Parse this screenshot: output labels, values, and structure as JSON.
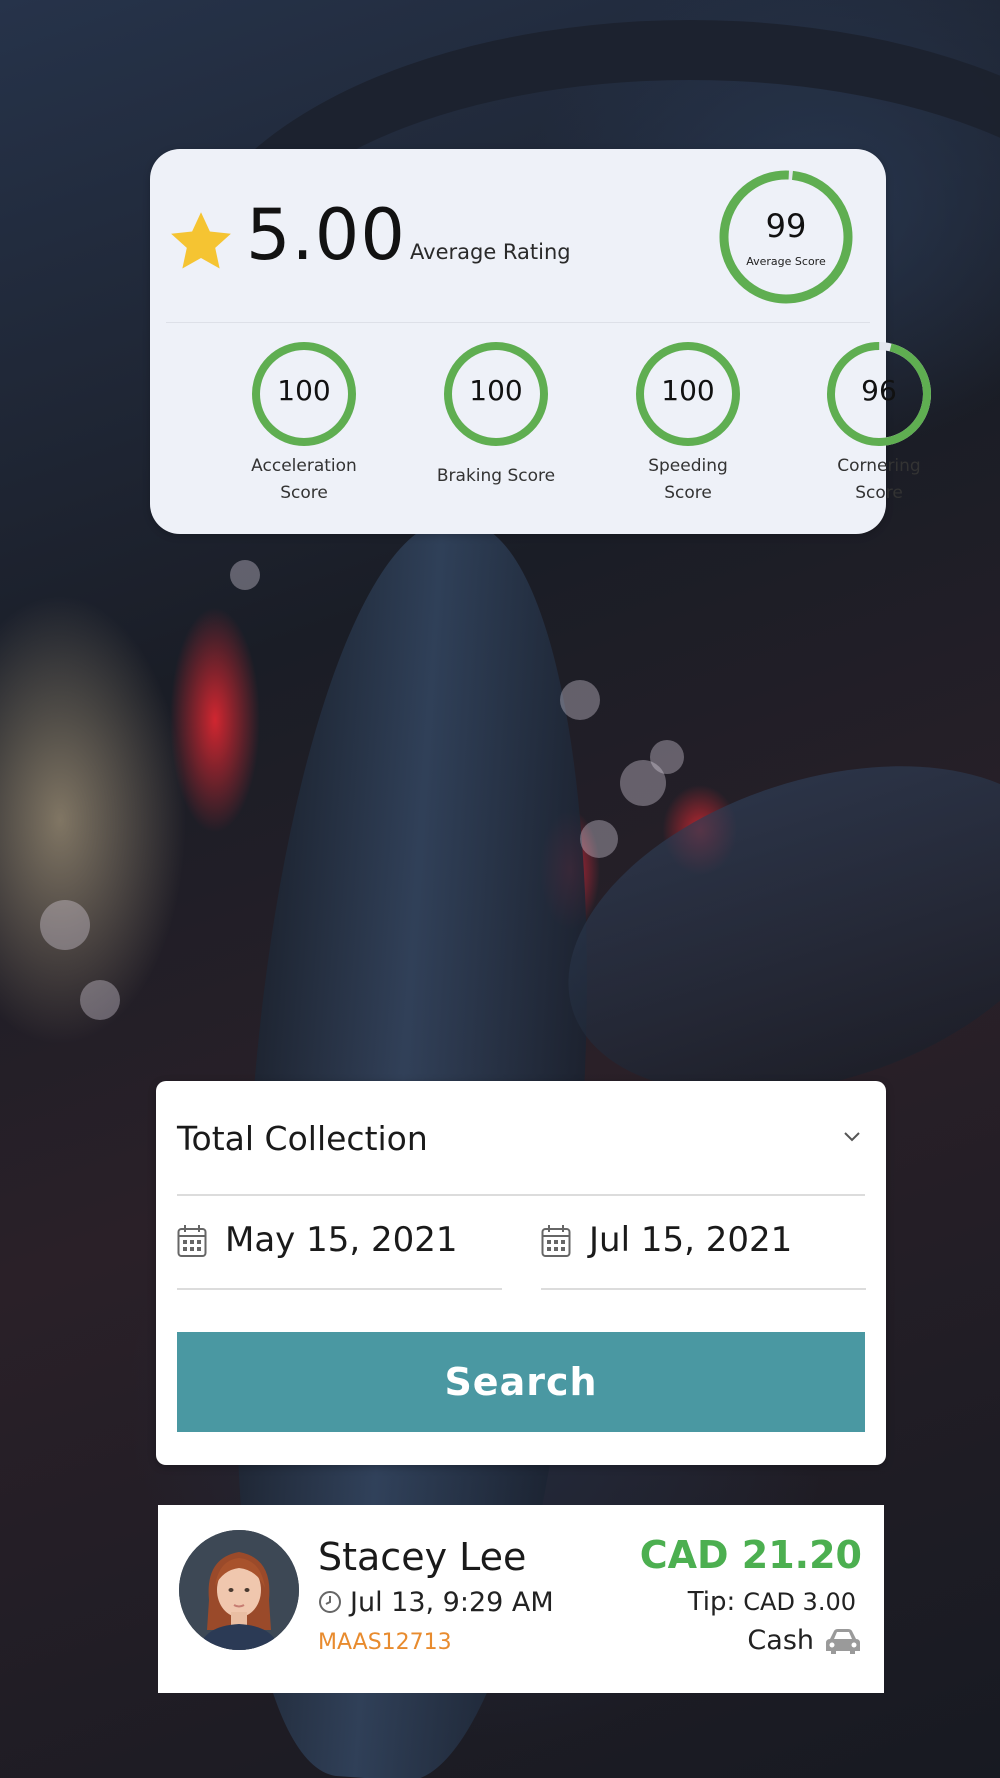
{
  "rating": {
    "value": "5.00",
    "label": "Average Rating",
    "icon": "star-icon",
    "star_color": "#f5c432"
  },
  "average_score": {
    "value": "99",
    "label": "Average Score",
    "percent": 99
  },
  "metrics": [
    {
      "value": "100",
      "label_line1": "Acceleration",
      "label_line2": "Score",
      "percent": 100
    },
    {
      "value": "100",
      "label_line1": "Braking Score",
      "label_line2": "",
      "percent": 100
    },
    {
      "value": "100",
      "label_line1": "Speeding",
      "label_line2": "Score",
      "percent": 100
    },
    {
      "value": "96",
      "label_line1": "Cornering",
      "label_line2": "Score",
      "percent": 96
    }
  ],
  "ring_color": "#5fae51",
  "filter": {
    "report_type": "Total Collection",
    "dropdown_icon": "chevron-down-icon",
    "start_date": "May 15, 2021",
    "end_date": "Jul 15, 2021",
    "date_icon": "calendar-icon",
    "search_label": "Search",
    "button_color": "#4a98a2"
  },
  "trip": {
    "name": "Stacey Lee",
    "time": "Jul 13, 9:29 AM",
    "time_icon": "clock-icon",
    "trip_id": "MAAS12713",
    "amount": "CAD 21.20",
    "tip_label": "Tip:",
    "tip_value": "CAD 3.00",
    "payment": "Cash",
    "payment_icon": "car-icon",
    "amount_color": "#4caf50",
    "id_color": "#e88b2e"
  }
}
